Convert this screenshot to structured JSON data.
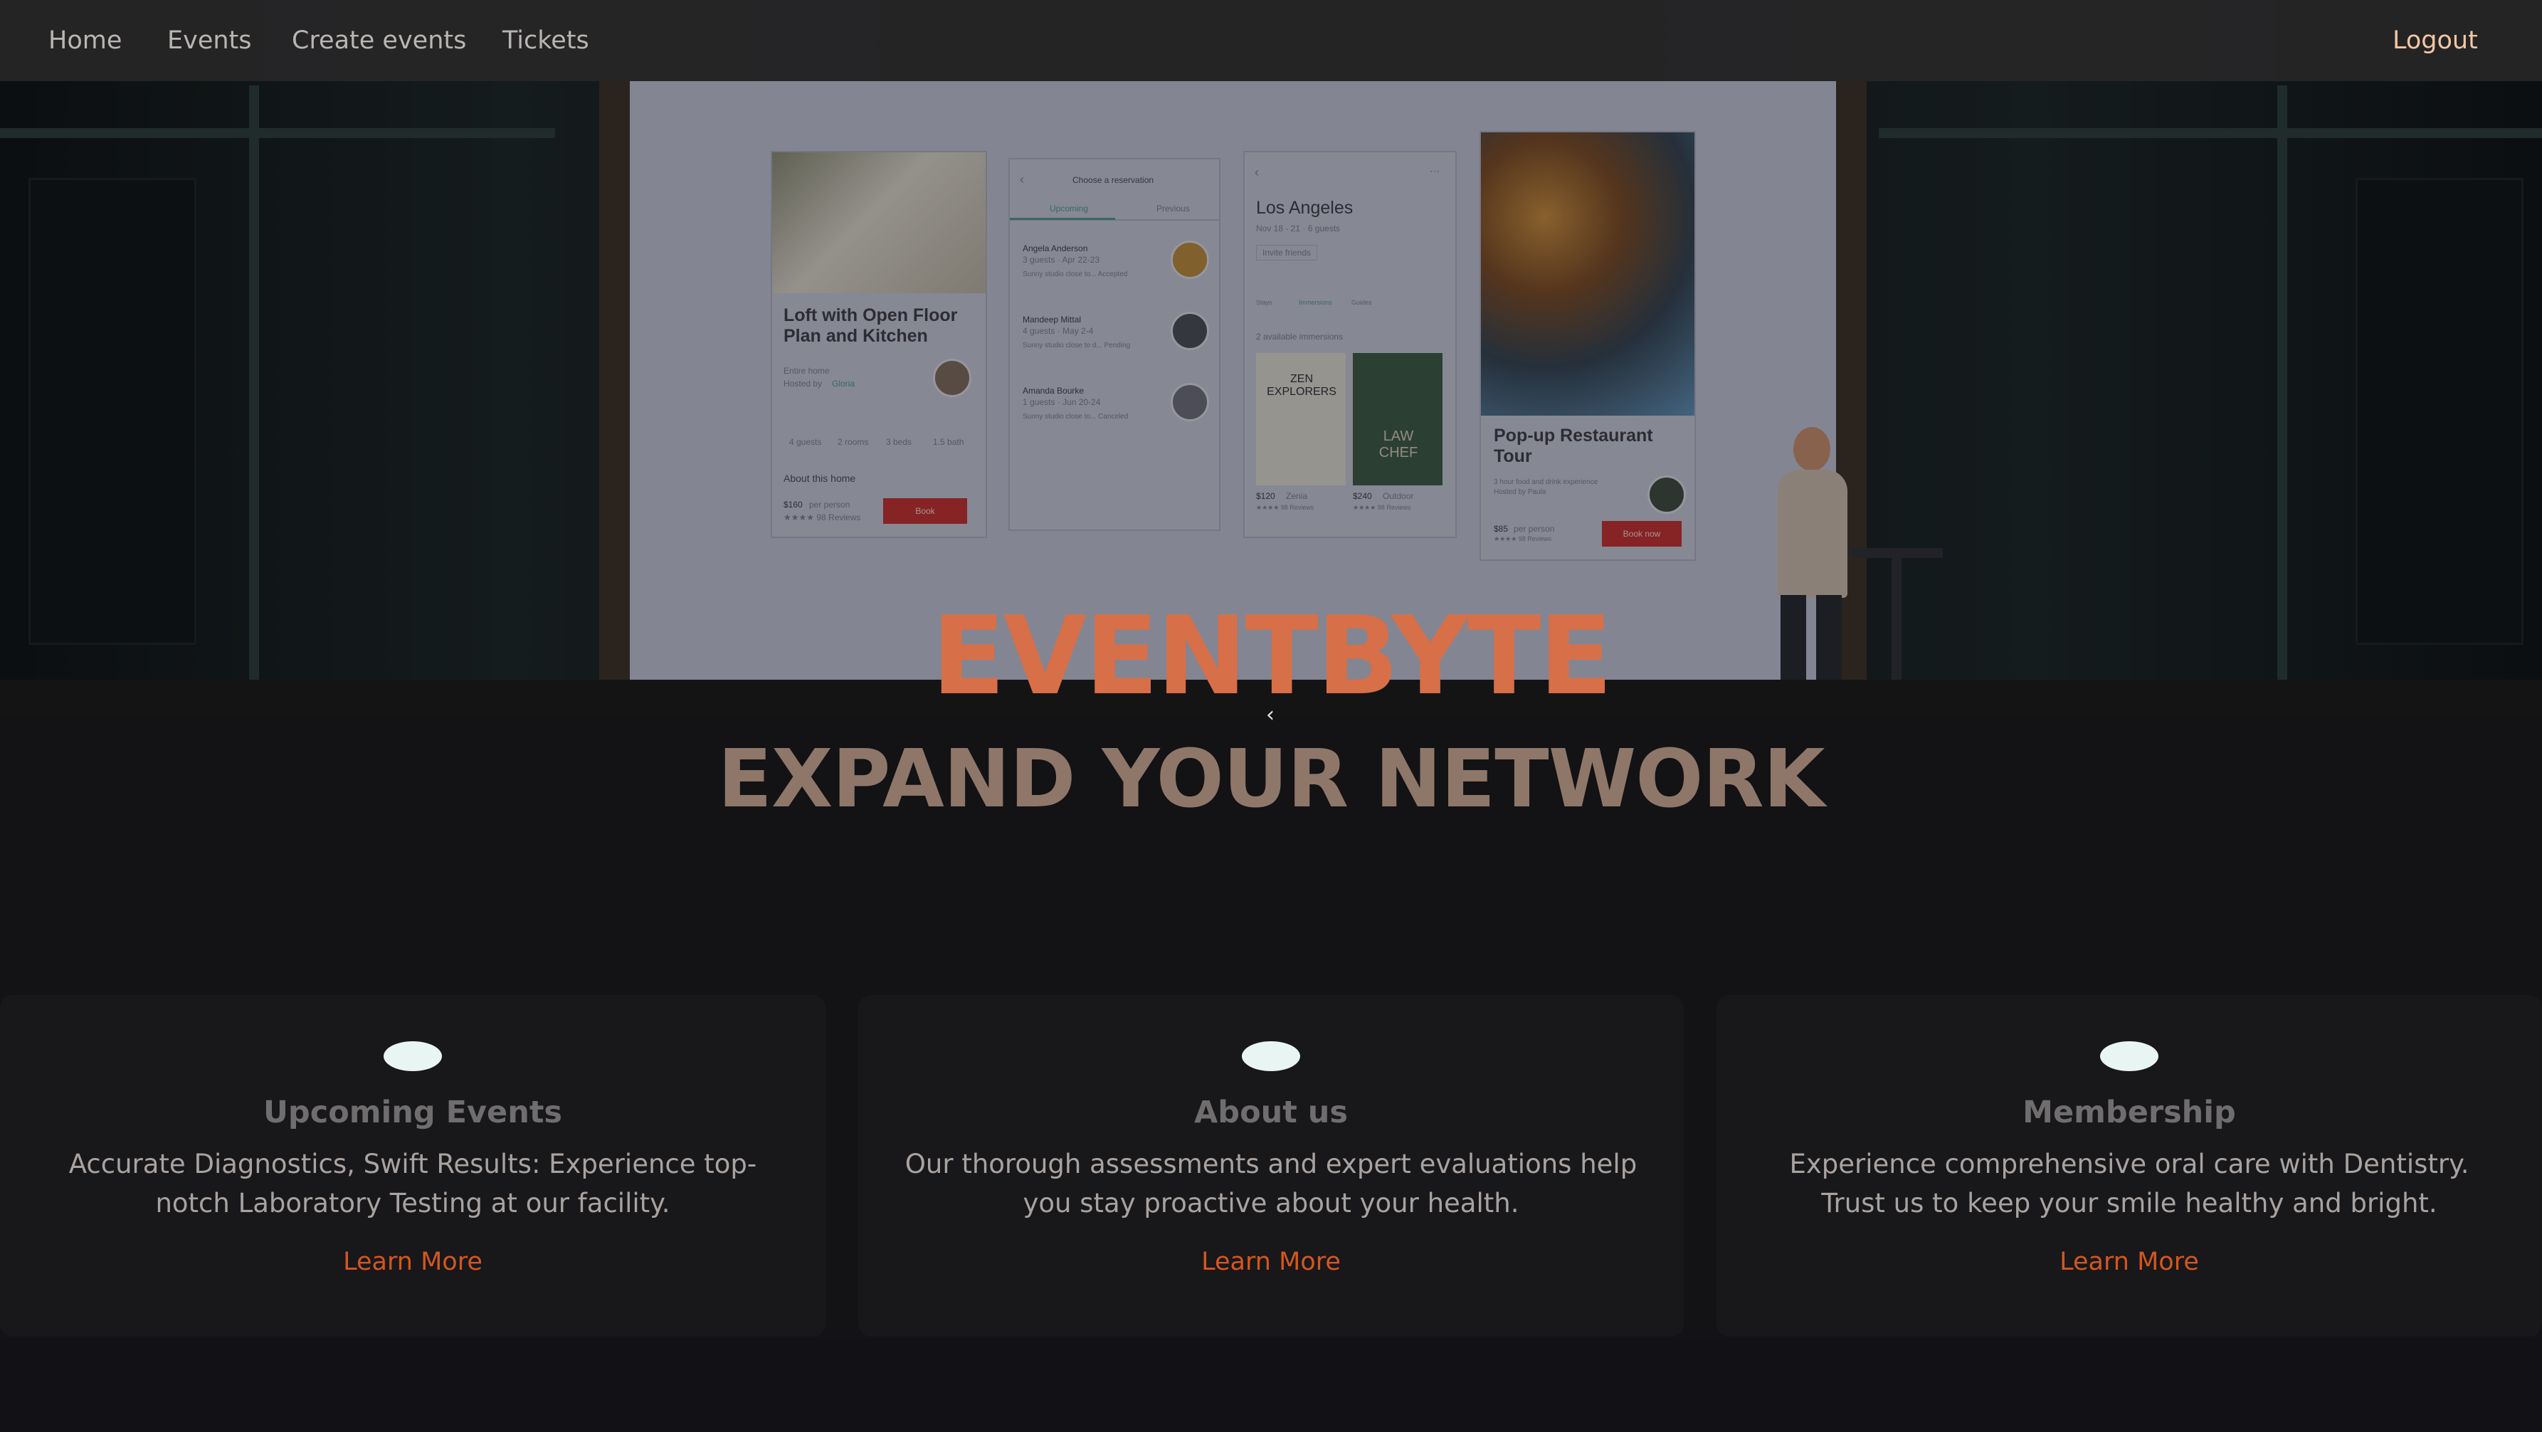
{
  "nav": {
    "items": [
      {
        "label": "Home"
      },
      {
        "label": "Events"
      },
      {
        "label": "Create events"
      },
      {
        "label": "Tickets"
      }
    ],
    "logout_label": "Logout"
  },
  "hero": {
    "brand": "EVENTBYTE",
    "tagline": "EXPAND YOUR NETWORK",
    "prev_icon": "chevron-left-icon",
    "slide_screen": {
      "card1": {
        "title": "Loft with Open Floor Plan and Kitchen",
        "sub1": "Entire home",
        "sub2": "Hosted by",
        "sub2_name": "Gloria",
        "stats": [
          "4 guests",
          "2 rooms",
          "3 beds",
          "1.5 bath"
        ],
        "section": "About this home",
        "price": "$160",
        "price_unit": "per person",
        "reviews": "★★★★ 98 Reviews",
        "button": "Book"
      },
      "card2": {
        "header": "Choose a reservation",
        "tab_upcoming": "Upcoming",
        "tab_previous": "Previous",
        "rows": [
          {
            "name": "Angela Anderson",
            "meta": "3 guests · Apr 22-23",
            "note": "Sunny studio close to... Accepted"
          },
          {
            "name": "Mandeep Mittal",
            "meta": "4 guests · May 2-4",
            "note": "Sunny studio close to d... Pending"
          },
          {
            "name": "Amanda Bourke",
            "meta": "1 guests · Jun 20-24",
            "note": "Sunny studio close to... Canceled"
          }
        ]
      },
      "card3": {
        "title": "Los Angeles",
        "meta": "Nov 18 - 21 · 6 guests",
        "chip": "Invite friends",
        "tabs": [
          "Stays",
          "Immersions",
          "Guides"
        ],
        "section": "2 available immersions",
        "book1_title": "ZEN EXPLORERS",
        "book2_title": "LAW CHEF",
        "price1": "$120",
        "label1": "Zenia",
        "price2": "$240",
        "label2": "Outdoor",
        "reviews1": "★★★★ 98 Reviews",
        "reviews2": "★★★★ 98 Reviews"
      },
      "card4": {
        "title": "Pop-up Restaurant Tour",
        "desc": "3 hour food and drink experience",
        "host": "Hosted by Paula",
        "price": "$85",
        "price_unit": "per person",
        "reviews": "★★★★ 98 Reviews",
        "button": "Book now"
      }
    }
  },
  "cards": [
    {
      "icon": "ellipse-icon",
      "title": "Upcoming Events",
      "description": "Accurate Diagnostics, Swift Results: Experience top-notch Laboratory Testing at our facility.",
      "link": "Learn More"
    },
    {
      "icon": "ellipse-icon",
      "title": "About us",
      "description": "Our thorough assessments and expert evaluations help you stay proactive about your health.",
      "link": "Learn More"
    },
    {
      "icon": "ellipse-icon",
      "title": "Membership",
      "description": "Experience comprehensive oral care with Dentistry. Trust us to keep your smile healthy and bright.",
      "link": "Learn More"
    }
  ],
  "colors": {
    "accent": "#d76f49",
    "link": "#d3571f",
    "background": "#131215",
    "card": "#18171a",
    "icon": "#e9f5f3"
  }
}
